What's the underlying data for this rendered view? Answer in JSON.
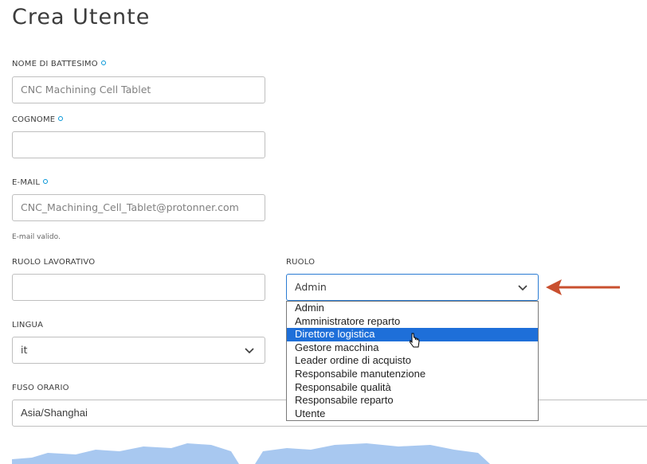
{
  "page": {
    "title": "Crea Utente"
  },
  "form": {
    "first_name": {
      "label": "NOME DI BATTESIMO",
      "value": "CNC Machining Cell Tablet"
    },
    "last_name": {
      "label": "COGNOME",
      "value": ""
    },
    "email": {
      "label": "E-MAIL",
      "value": "CNC_Machining_Cell_Tablet@protonner.com",
      "hint": "E-mail valido."
    },
    "job_role": {
      "label": "RUOLO LAVORATIVO",
      "value": ""
    },
    "role": {
      "label": "RUOLO",
      "value": "Admin",
      "options": [
        "Admin",
        "Amministratore reparto",
        "Direttore logistica",
        "Gestore macchina",
        "Leader ordine di acquisto",
        "Responsabile manutenzione",
        "Responsabile qualità",
        "Responsabile reparto",
        "Utente"
      ],
      "highlighted_index": 2
    },
    "language": {
      "label": "LINGUA",
      "value": "it"
    },
    "timezone": {
      "label": "FUSO ORARIO",
      "value": "Asia/Shanghai"
    }
  },
  "colors": {
    "accent": "#0696d7",
    "highlight": "#1e6fd9",
    "annotation_arrow": "#c9502f",
    "map": "#a8c8f0"
  },
  "icons": {
    "select_chevron": "chevron-down-icon",
    "annotation": "arrow-left-icon",
    "pointer": "mouse-cursor-icon"
  }
}
